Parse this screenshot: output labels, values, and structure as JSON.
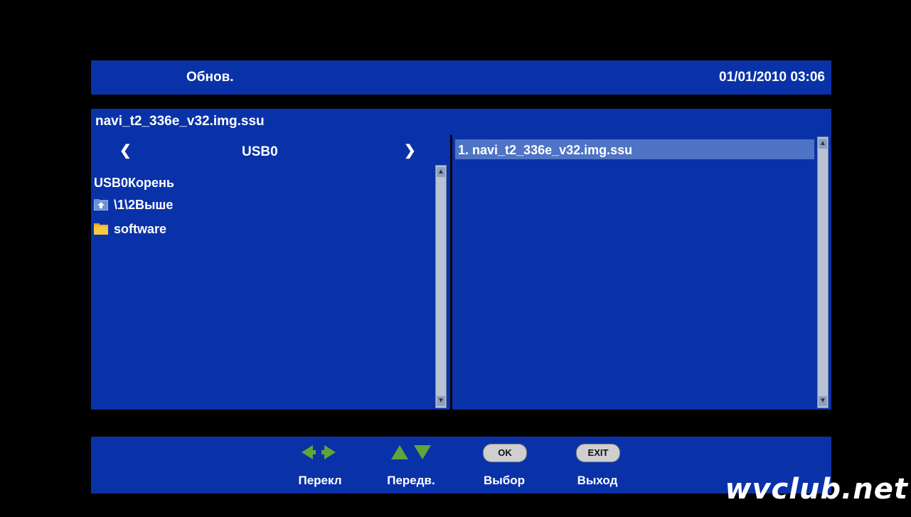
{
  "header": {
    "title": "Обнов.",
    "datetime": "01/01/2010 03:06"
  },
  "file_bar": {
    "filename": "navi_t2_336e_v32.img.ssu"
  },
  "left_pane": {
    "device": "USB0",
    "root": "USB0Корень",
    "items": [
      {
        "label": "\\1\\2Выше",
        "icon": "folder-up-icon"
      },
      {
        "label": "software",
        "icon": "folder-icon"
      }
    ]
  },
  "right_pane": {
    "files": [
      "1. navi_t2_336e_v32.img.ssu"
    ]
  },
  "footer": {
    "buttons": [
      {
        "label": "Перекл",
        "icon": "left-right-arrows-icon"
      },
      {
        "label": "Передв.",
        "icon": "up-down-arrows-icon"
      },
      {
        "label": "Выбор",
        "key": "OK"
      },
      {
        "label": "Выход",
        "key": "EXIT"
      }
    ]
  },
  "watermark": "wvclub.net",
  "colors": {
    "panel": "#0a32a8",
    "selection": "#4f74c6",
    "background": "#000000",
    "arrows": "#5fa53a"
  }
}
